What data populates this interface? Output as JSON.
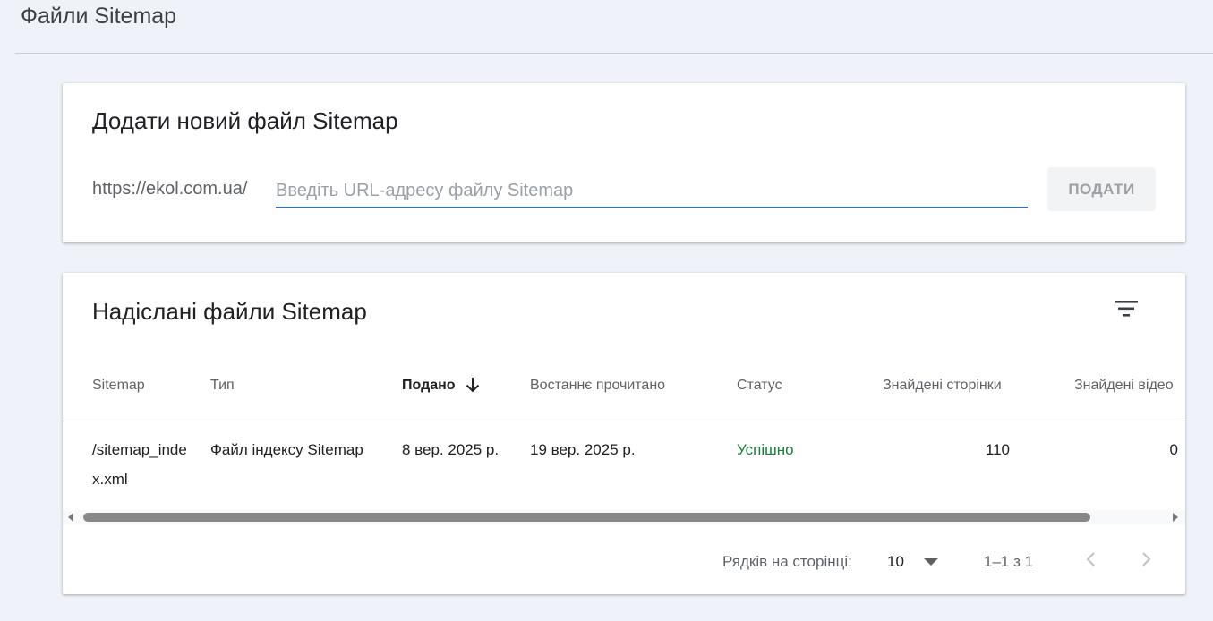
{
  "header": {
    "title": "Файли Sitemap"
  },
  "add_sitemap": {
    "title": "Додати новий файл Sitemap",
    "url_prefix": "https://ekol.com.ua/",
    "input_placeholder": "Введіть URL-адресу файлу Sitemap",
    "input_value": "",
    "submit_label": "ПОДАТИ"
  },
  "submitted": {
    "title": "Надіслані файли Sitemap",
    "filter_icon": "filter-list-icon",
    "columns": [
      "Sitemap",
      "Тип",
      "Подано",
      "Востаннє прочитано",
      "Статус",
      "Знайдені сторінки",
      "Знайдені відео"
    ],
    "sorted_column": "Подано",
    "sort_direction": "descending",
    "rows": [
      {
        "sitemap": "/sitemap_index.xml",
        "type": "Файл індексу Sitemap",
        "submitted": "8 вер. 2025 р.",
        "last_read": "19 вер. 2025 р.",
        "status": "Успішно",
        "pages": "110",
        "videos": "0"
      }
    ],
    "pagination": {
      "rows_per_page_label": "Рядків на сторінці:",
      "rows_per_page": "10",
      "range": "1–1 з 1"
    }
  },
  "colors": {
    "background": "#eff2f8",
    "card": "#ffffff",
    "accent": "#1a73e8",
    "status_success": "#188038",
    "muted_text": "#5f6368"
  }
}
